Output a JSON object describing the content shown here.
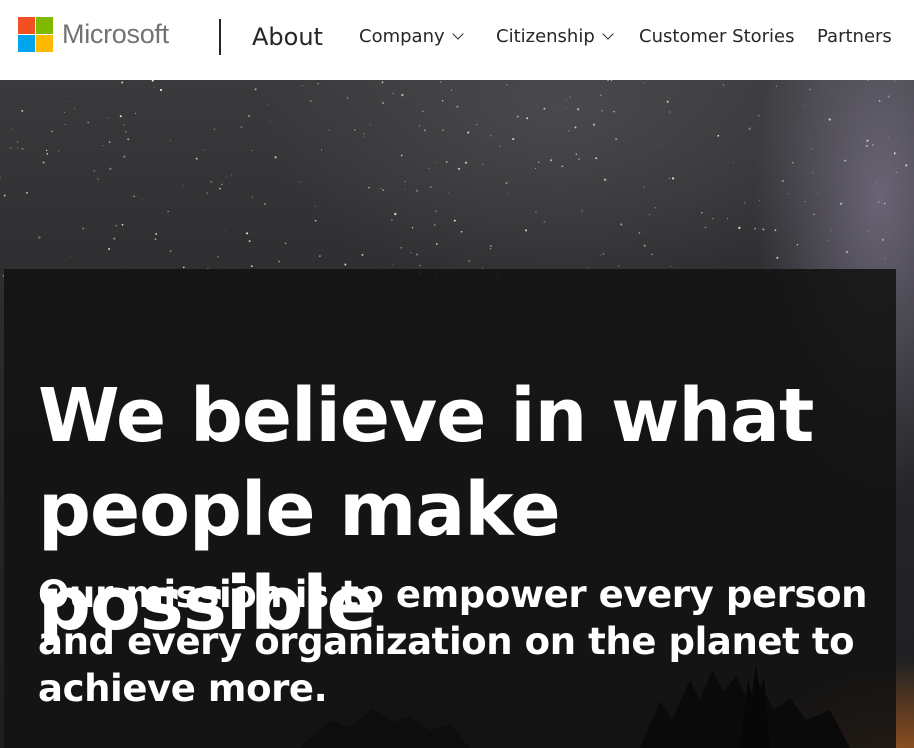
{
  "brand": {
    "name": "Microsoft",
    "logo_colors": [
      "#f25022",
      "#7fba00",
      "#00a4ef",
      "#ffb900"
    ]
  },
  "header": {
    "section_title": "About",
    "nav": [
      {
        "label": "Company",
        "has_dropdown": true
      },
      {
        "label": "Citizenship",
        "has_dropdown": true
      },
      {
        "label": "Customer Stories",
        "has_dropdown": false
      },
      {
        "label": "Partners",
        "has_dropdown": false
      }
    ]
  },
  "hero": {
    "headline": "We believe in what people make possible",
    "subline": "Our mission is to empower every person and every organization on the planet to achieve more.",
    "overlay_color": "#121212"
  }
}
